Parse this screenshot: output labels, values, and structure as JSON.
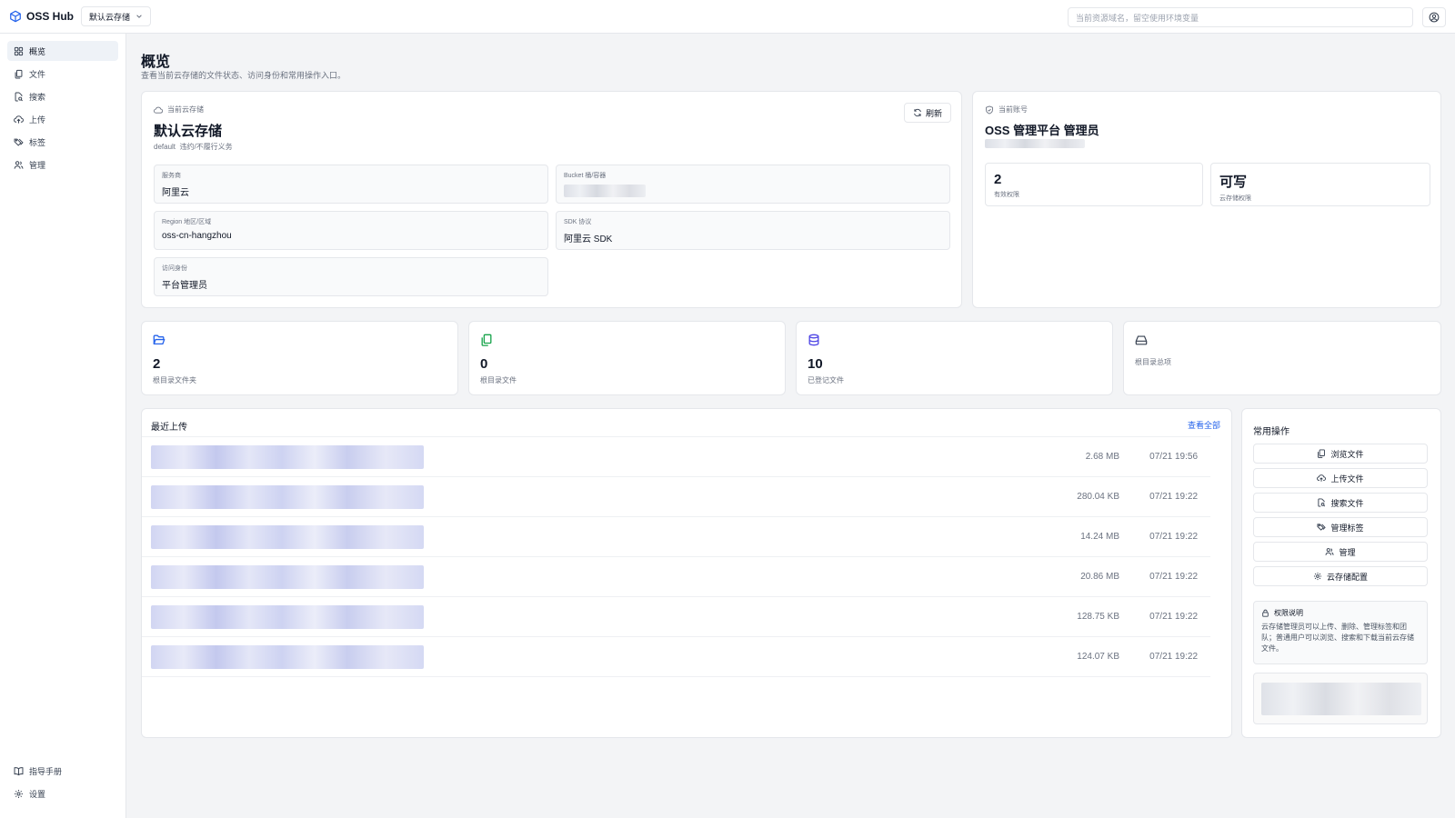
{
  "header": {
    "brand": "OSS Hub",
    "storage_selector": "默认云存储",
    "search_placeholder": "当前资源域名，留空使用环境变量"
  },
  "sidebar": {
    "items": [
      {
        "label": "概览",
        "icon": "grid-icon",
        "active": true
      },
      {
        "label": "文件",
        "icon": "files-icon"
      },
      {
        "label": "搜索",
        "icon": "file-search-icon"
      },
      {
        "label": "上传",
        "icon": "cloud-upload-icon"
      },
      {
        "label": "标签",
        "icon": "tags-icon"
      },
      {
        "label": "管理",
        "icon": "users-icon"
      }
    ],
    "bottom": [
      {
        "label": "指导手册",
        "icon": "book-icon"
      },
      {
        "label": "设置",
        "icon": "gear-icon"
      }
    ]
  },
  "page": {
    "title": "概览",
    "description": "查看当前云存储的文件状态、访问身份和常用操作入口。"
  },
  "storage_card": {
    "caption": "当前云存储",
    "name": "默认云存储",
    "subtitle": "default  违约/不履行义务",
    "refresh_label": "刷新",
    "fields": [
      {
        "label": "服务商",
        "value": "阿里云"
      },
      {
        "label": "Bucket  桶/容器",
        "value": ""
      },
      {
        "label": "Region  地区/区域",
        "value": "oss-cn-hangzhou"
      },
      {
        "label": "SDK 协议",
        "value": "阿里云 SDK"
      },
      {
        "label": "访问身份",
        "value": "平台管理员"
      }
    ]
  },
  "account_card": {
    "caption": "当前账号",
    "name": "OSS 管理平台 管理员",
    "stats": [
      {
        "value": "2",
        "label": "有效权限"
      },
      {
        "value": "可写",
        "label": "云存储权限"
      }
    ]
  },
  "metrics": [
    {
      "value": "2",
      "label": "根目录文件夹",
      "icon": "folder-open-icon",
      "color": "#2563eb"
    },
    {
      "value": "0",
      "label": "根目录文件",
      "icon": "files-icon",
      "color": "#16a34a"
    },
    {
      "value": "10",
      "label": "已登记文件",
      "icon": "database-icon",
      "color": "#4f46e5"
    },
    {
      "value": "",
      "label": "根目录总项",
      "icon": "hard-drive-icon",
      "color": "#374151"
    }
  ],
  "recent_uploads": {
    "title": "最近上传",
    "view_all": "查看全部",
    "rows": [
      {
        "size": "2.68 MB",
        "time": "07/21 19:56"
      },
      {
        "size": "280.04 KB",
        "time": "07/21 19:22"
      },
      {
        "size": "14.24 MB",
        "time": "07/21 19:22"
      },
      {
        "size": "20.86 MB",
        "time": "07/21 19:22"
      },
      {
        "size": "128.75 KB",
        "time": "07/21 19:22"
      },
      {
        "size": "124.07 KB",
        "time": "07/21 19:22"
      }
    ]
  },
  "quick_actions": {
    "title": "常用操作",
    "buttons": [
      {
        "label": "浏览文件",
        "icon": "files-icon"
      },
      {
        "label": "上传文件",
        "icon": "cloud-upload-icon"
      },
      {
        "label": "搜索文件",
        "icon": "file-search-icon"
      },
      {
        "label": "管理标签",
        "icon": "tags-icon"
      },
      {
        "label": "管理",
        "icon": "users-icon"
      },
      {
        "label": "云存储配置",
        "icon": "gear-icon"
      }
    ],
    "permission": {
      "title": "权限说明",
      "text": "云存储管理员可以上传、删除、管理标签和团队；普通用户可以浏览、搜索和下载当前云存储文件。"
    }
  },
  "colors": {
    "accent": "#2563eb",
    "background": "#f3f4f6",
    "card": "#ffffff",
    "border": "#e5e7eb"
  }
}
